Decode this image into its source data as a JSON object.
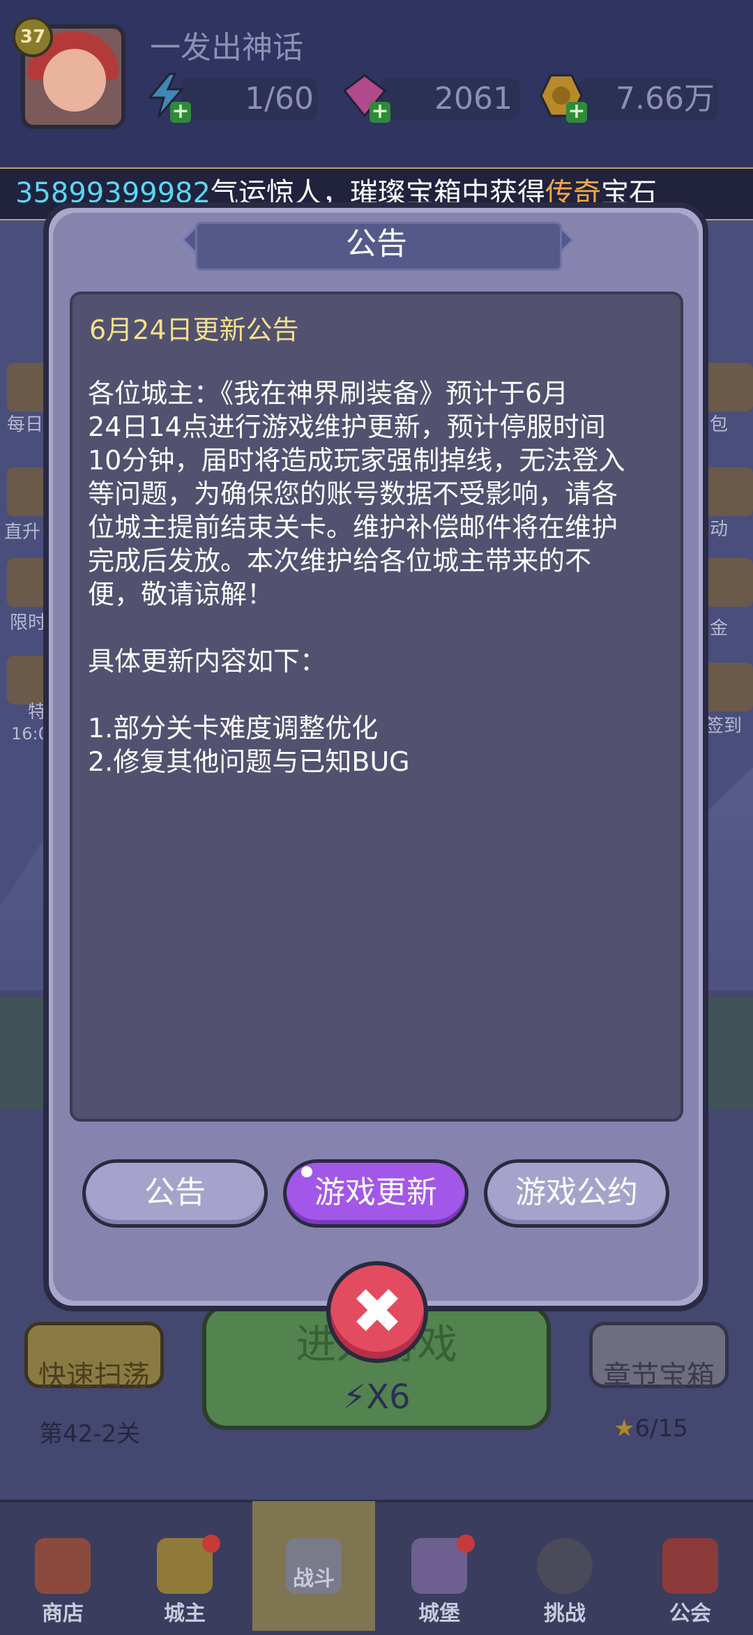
{
  "header": {
    "level": "37",
    "player_name": "一发出神话",
    "energy": "1/60",
    "gems": "2061",
    "gold": "7.66万"
  },
  "marquee": {
    "number": "35899399982",
    "text_a": "气运惊人，璀璨宝箱中获得",
    "highlight": "传奇",
    "text_b": "宝石"
  },
  "side_left": [
    "每日",
    "直升",
    "限时",
    "特",
    "16:0"
  ],
  "side_right": [
    "包",
    "动",
    "金",
    "签到"
  ],
  "dialog": {
    "title": "公告",
    "content_title": "6月24日更新公告",
    "content_body": "各位城主：《我在神界刷装备》预计于6月\n24日14点进行游戏维护更新，预计停服时间\n10分钟，届时将造成玩家强制掉线，无法登入\n等问题，为确保您的账号数据不受影响，请各\n位城主提前结束关卡。维护补偿邮件将在维护\n完成后发放。本次维护给各位城主带来的不\n便，敬请谅解！\n\n具体更新内容如下：\n\n1.部分关卡难度调整优化\n2.修复其他问题与已知BUG",
    "tabs": [
      {
        "label": "公告",
        "active": false
      },
      {
        "label": "游戏更新",
        "active": true
      },
      {
        "label": "游戏公约",
        "active": false
      }
    ]
  },
  "game": {
    "quick_sweep": "快速扫荡",
    "stage": "第42-2关",
    "enter_game": "进入游戏",
    "energy_cost": "X6",
    "chapter_chest": "章节宝箱",
    "chapter_progress": "6/15"
  },
  "nav": [
    {
      "label": "商店",
      "active": false
    },
    {
      "label": "城主",
      "active": false
    },
    {
      "label": "战斗",
      "active": true
    },
    {
      "label": "城堡",
      "active": false
    },
    {
      "label": "挑战",
      "active": false
    },
    {
      "label": "公会",
      "active": false
    }
  ],
  "colors": {
    "accent_purple": "#a257e8",
    "highlight_orange": "#f5a640",
    "number_cyan": "#59d8f0",
    "close_red": "#e34b60"
  }
}
